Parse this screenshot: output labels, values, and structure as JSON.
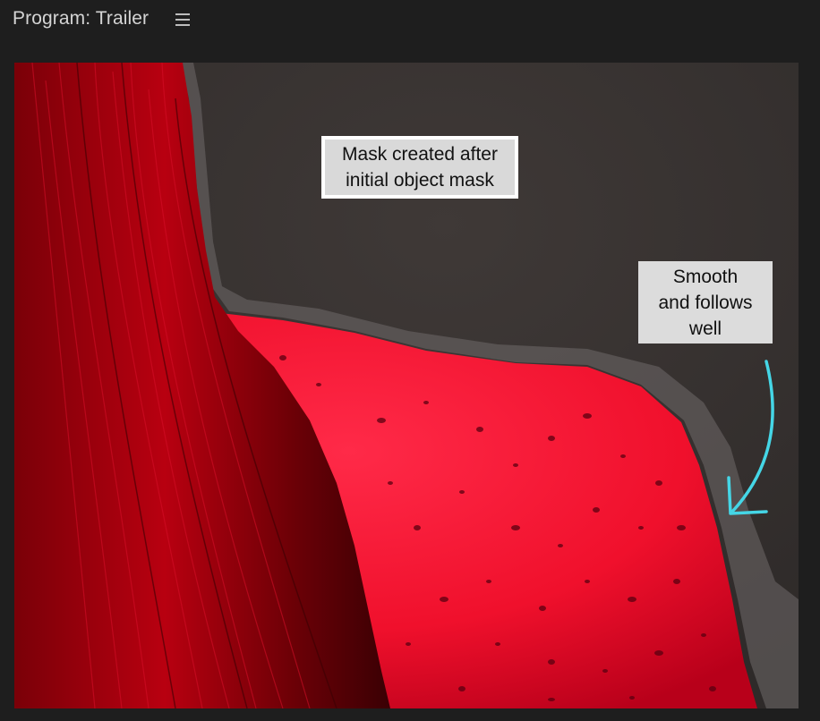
{
  "panel": {
    "title": "Program: Trailer",
    "menu_icon": "hamburger-menu-icon"
  },
  "annotations": {
    "mask_note": {
      "line1": "Mask created after",
      "line2": "initial object mask"
    },
    "smooth_note": {
      "line1": "Smooth",
      "line2": "and follows",
      "line3": "well"
    },
    "arrow_icon": "curved-arrow-icon",
    "arrow_color": "#45d6e6"
  },
  "colors": {
    "panel_bg": "#1e1e1e",
    "title_text": "#d4d4d4",
    "mask_overlay": "#ff1030",
    "background_wall": "#3a3533"
  }
}
